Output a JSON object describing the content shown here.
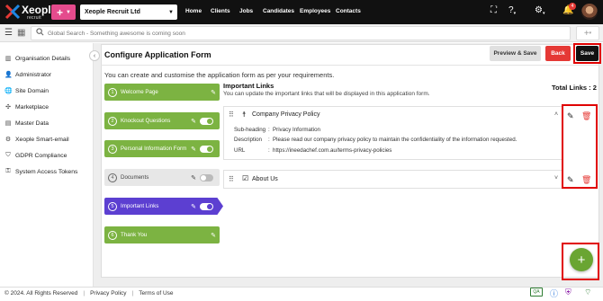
{
  "app": {
    "logo_text": "Xeople",
    "logo_sub": "recruit",
    "add_label": "+",
    "company": "Xeople Recruit Ltd"
  },
  "nav": [
    "Home",
    "Clients",
    "Jobs",
    "Candidates",
    "Employees",
    "Contacts"
  ],
  "notifications": {
    "count": "4"
  },
  "search": {
    "placeholder": "Global Search - Something awesome is coming soon",
    "add_label": "+"
  },
  "sidebar": {
    "items": [
      {
        "label": "Organisation Details",
        "icon": "building-icon"
      },
      {
        "label": "Administrator",
        "icon": "person-icon"
      },
      {
        "label": "Site Domain",
        "icon": "globe-icon"
      },
      {
        "label": "Marketplace",
        "icon": "marketplace-icon"
      },
      {
        "label": "Master Data",
        "icon": "database-icon"
      },
      {
        "label": "Xeople Smart-email",
        "icon": "smart-email-icon"
      },
      {
        "label": "GDPR Compliance",
        "icon": "shield-icon"
      },
      {
        "label": "System Access Tokens",
        "icon": "key-icon"
      }
    ]
  },
  "page": {
    "title": "Configure Application Form",
    "preview_label": "Preview & Save",
    "back_label": "Back",
    "save_label": "Save",
    "intro": "You can create and customise the application form as per your requirements."
  },
  "steps": [
    {
      "num": "1",
      "label": "Welcome Page",
      "state": "green",
      "toggle": false
    },
    {
      "num": "2",
      "label": "Knockout Questions",
      "state": "green",
      "toggle": true
    },
    {
      "num": "3",
      "label": "Personal Information Form",
      "state": "green",
      "toggle": true
    },
    {
      "num": "4",
      "label": "Documents",
      "state": "gray",
      "toggle": true
    },
    {
      "num": "5",
      "label": "Important Links",
      "state": "purple",
      "toggle": true
    },
    {
      "num": "6",
      "label": "Thank You",
      "state": "green",
      "toggle": false
    }
  ],
  "links_section": {
    "title": "Important Links",
    "subtitle": "You can update the important links that will be displayed in this application form.",
    "total": "Total Links : 2",
    "links": [
      {
        "title": "Company Privacy Policy",
        "details": [
          {
            "label": "Sub-heading",
            "value": "Privacy Information"
          },
          {
            "label": "Description",
            "value": "Please read our company privacy policy to maintain the confidentiality of the information requested."
          },
          {
            "label": "URL",
            "value": "https://ineedachef.com.au/terms-privacy-policies"
          }
        ]
      },
      {
        "title": "About Us"
      }
    ]
  },
  "footer": {
    "copyright": "© 2024. All Rights Reserved",
    "privacy": "Privacy Policy",
    "terms": "Terms of Use",
    "qa": "QA"
  },
  "colors": {
    "accent_green": "#7cb342",
    "active_purple": "#5c3fd1",
    "danger_red": "#e53935",
    "brand_pink": "#e44b8d"
  }
}
